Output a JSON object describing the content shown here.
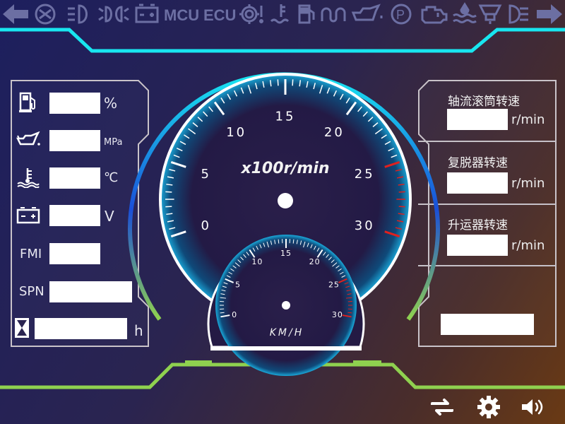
{
  "top_icons": [
    "arrow-left-icon",
    "tire-icon",
    "headlight-icon",
    "sidelight-icon",
    "battery-icon",
    "mcu-text",
    "ecu-text",
    "gear-warning-icon",
    "coolant-temp-icon",
    "fuel-icon",
    "glow-plug-icon",
    "oil-pressure-icon",
    "parking-brake-icon",
    "engine-check-icon",
    "water-in-fuel-icon",
    "oil-filter-icon",
    "high-beam-icon",
    "arrow-right-icon"
  ],
  "top_text": {
    "mcu": "MCU",
    "ecu": "ECU"
  },
  "left_panel": {
    "fuel_unit": "%",
    "oil_unit": "MPa",
    "temp_unit": "℃",
    "voltage_unit": "V",
    "fmi_label": "FMI",
    "spn_label": "SPN",
    "hour_unit": "h"
  },
  "right_panel": {
    "items": [
      {
        "title": "轴流滚筒转速",
        "unit": "r/min"
      },
      {
        "title": "复脱器转速",
        "unit": "r/min"
      },
      {
        "title": "升运器转速",
        "unit": "r/min"
      }
    ]
  },
  "tachometer": {
    "label": "x100r/min",
    "ticks": [
      "0",
      "5",
      "10",
      "15",
      "20",
      "25",
      "30"
    ],
    "min": 0,
    "max": 30,
    "redline_from": 25
  },
  "speedometer": {
    "label": "KM/H",
    "ticks": [
      "0",
      "5",
      "10",
      "15",
      "20",
      "25",
      "30"
    ],
    "min": 0,
    "max": 30,
    "redline_from": 25
  },
  "bottom_icons": [
    "switch-icon",
    "settings-gear-icon",
    "volume-icon"
  ],
  "colors": {
    "cyan": "#18e6f0",
    "green": "#8fd14f",
    "panel_border": "#c9c3c9",
    "red": "#e0201e",
    "blue_ring": "#1a4fd8"
  }
}
